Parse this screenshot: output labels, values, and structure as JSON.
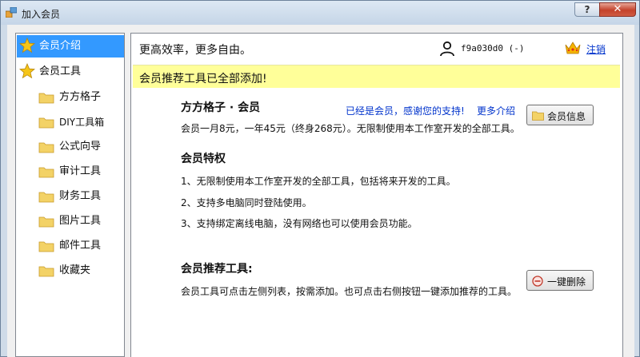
{
  "window": {
    "title": "加入会员",
    "help_label": "?",
    "close_label": "✕"
  },
  "sidebar": {
    "items": [
      {
        "label": "会员介绍",
        "icon": "star-icon"
      },
      {
        "label": "会员工具",
        "icon": "star-icon"
      },
      {
        "label": "方方格子",
        "icon": "folder-icon"
      },
      {
        "label": "DIY工具箱",
        "icon": "folder-icon"
      },
      {
        "label": "公式向导",
        "icon": "folder-icon"
      },
      {
        "label": "审计工具",
        "icon": "folder-icon"
      },
      {
        "label": "财务工具",
        "icon": "folder-icon"
      },
      {
        "label": "图片工具",
        "icon": "folder-icon"
      },
      {
        "label": "邮件工具",
        "icon": "folder-icon"
      },
      {
        "label": "收藏夹",
        "icon": "folder-icon"
      }
    ]
  },
  "header": {
    "title": "更高效率，更多自由。",
    "user_id": "f9a030d0 (-)",
    "logout": "注销"
  },
  "banner": {
    "text": "会员推荐工具已全部添加!"
  },
  "membership": {
    "title": "方方格子 · 会员",
    "already_member": "已经是会员，感谢您的支持!",
    "more_info": "更多介绍",
    "info_button": "会员信息",
    "price": "会员一月8元，一年45元（终身268元）。无限制使用本工作室开发的全部工具。"
  },
  "privileges": {
    "title": "会员特权",
    "items": [
      "1、无限制使用本工作室开发的全部工具，包括将来开发的工具。",
      "2、支持多电脑同时登陆使用。",
      "3、支持绑定离线电脑，没有网络也可以使用会员功能。"
    ]
  },
  "recommended": {
    "title": "会员推荐工具:",
    "description": "会员工具可点击左侧列表，按需添加。也可点击右侧按钮一键添加推荐的工具。",
    "delete_button": "一键删除"
  },
  "colors": {
    "selected": "#3399ff",
    "banner": "#ffff99",
    "link": "#0033cc"
  }
}
